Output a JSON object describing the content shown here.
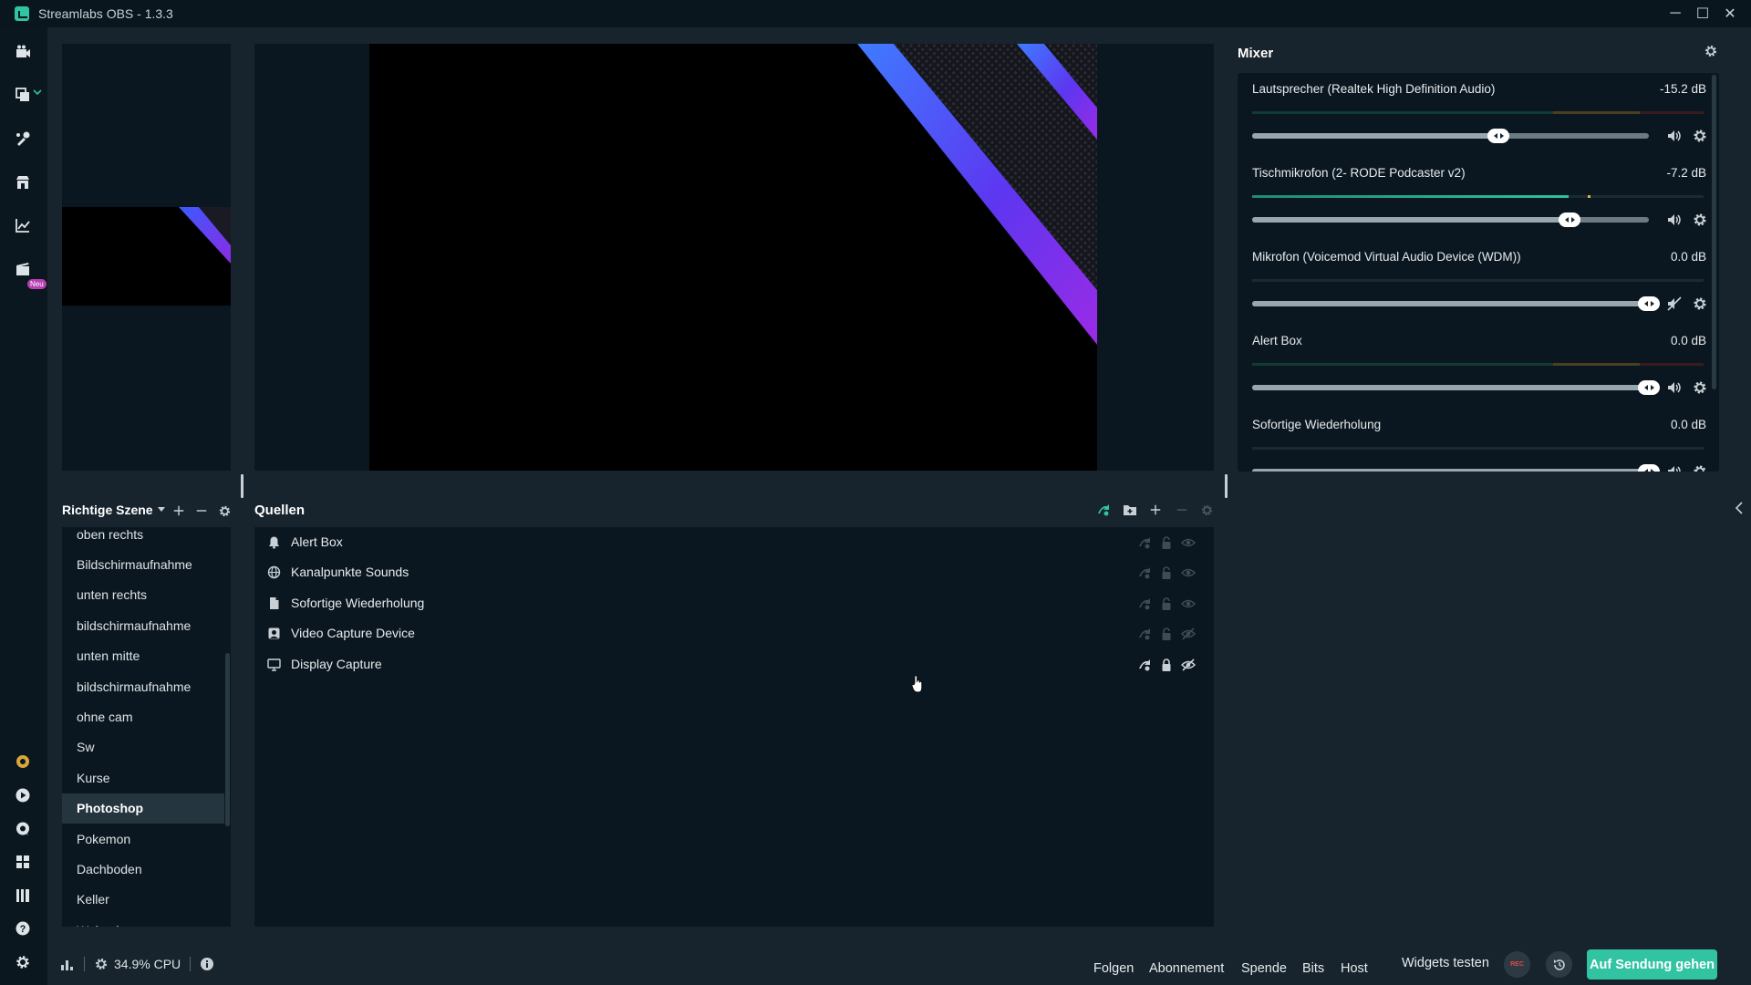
{
  "window": {
    "title": "Streamlabs OBS - 1.3.3",
    "controls": {
      "minimize": "─",
      "maximize": "☐",
      "close": "✕"
    }
  },
  "leftnav": {
    "items": [
      {
        "name": "editor-icon"
      },
      {
        "name": "layout-editor-icon"
      },
      {
        "name": "theme-library-icon"
      },
      {
        "name": "app-store-icon"
      },
      {
        "name": "dashboard-stats-icon"
      },
      {
        "name": "studio-mode-icon",
        "badge": "Neu"
      }
    ],
    "bottom_items": [
      {
        "name": "prime-icon"
      },
      {
        "name": "play-icon"
      },
      {
        "name": "chat-icon"
      },
      {
        "name": "apps-grid-icon"
      },
      {
        "name": "library-icon"
      },
      {
        "name": "help-icon"
      },
      {
        "name": "settings-icon"
      }
    ]
  },
  "mixer": {
    "title": "Mixer",
    "items": [
      {
        "name": "Lautsprecher (Realtek High Definition Audio)",
        "db": "-15.2 dB",
        "level": 0.62,
        "meter": 0.0,
        "muted": false
      },
      {
        "name": "Tischmikrofon (2- RODE Podcaster v2)",
        "db": "-7.2 dB",
        "level": 0.8,
        "meter": 0.7,
        "muted": false
      },
      {
        "name": "Mikrofon (Voicemod Virtual Audio Device (WDM))",
        "db": "0.0 dB",
        "level": 1.0,
        "meter": 0.0,
        "muted": true
      },
      {
        "name": "Alert Box",
        "db": "0.0 dB",
        "level": 1.0,
        "meter": 0.0,
        "muted": false
      },
      {
        "name": "Sofortige Wiederholung",
        "db": "0.0 dB",
        "level": 1.0,
        "meter": 0.0,
        "muted": false
      }
    ]
  },
  "scenes": {
    "title": "Richtige Szene",
    "items": [
      "oben rechts",
      "Bildschirmaufnahme",
      "unten rechts",
      "bildschirmaufnahme",
      "unten mitte",
      "bildschirmaufnahme",
      "ohne cam",
      "Sw",
      "Kurse",
      "Photoshop",
      "Pokemon",
      "Dachboden",
      "Keller",
      "Wohnzimmer"
    ],
    "active_index": 9
  },
  "sources": {
    "title": "Quellen",
    "items": [
      {
        "name": "Alert Box",
        "icon": "bell-icon",
        "active": false
      },
      {
        "name": "Kanalpunkte Sounds",
        "icon": "globe-icon",
        "active": false
      },
      {
        "name": "Sofortige Wiederholung",
        "icon": "file-icon",
        "active": false
      },
      {
        "name": "Video Capture Device",
        "icon": "camera-icon",
        "active": false
      },
      {
        "name": "Display Capture",
        "icon": "monitor-icon",
        "active": true
      }
    ]
  },
  "footer": {
    "cpu": "34.9% CPU",
    "links": [
      "Folgen",
      "Abonnement",
      "Spende",
      "Bits",
      "Host"
    ],
    "widgets_label": "Widgets testen",
    "rec_label": "REC",
    "go_live_label": "Auf Sendung gehen"
  },
  "colors": {
    "accent": "#31c3a2",
    "background": "#17242d",
    "panel": "#0b1720",
    "meter_green": "#2ec39a",
    "meter_yellow": "#d8b43a"
  }
}
